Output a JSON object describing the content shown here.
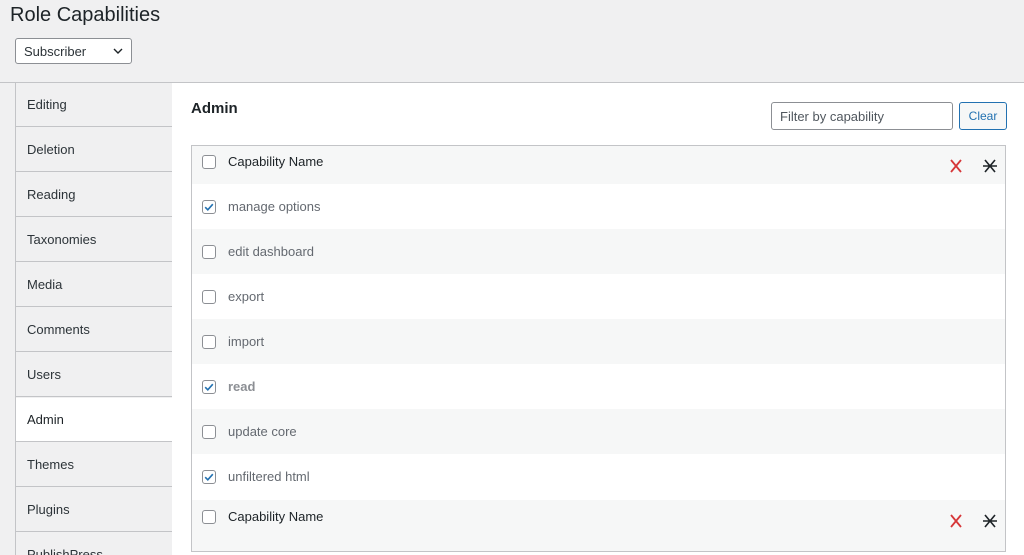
{
  "header": {
    "title": "Role Capabilities",
    "role_select": {
      "value": "Subscriber"
    }
  },
  "sidebar": {
    "items": [
      {
        "label": "Editing",
        "active": false
      },
      {
        "label": "Deletion",
        "active": false
      },
      {
        "label": "Reading",
        "active": false
      },
      {
        "label": "Taxonomies",
        "active": false
      },
      {
        "label": "Media",
        "active": false
      },
      {
        "label": "Comments",
        "active": false
      },
      {
        "label": "Users",
        "active": false
      },
      {
        "label": "Admin",
        "active": true
      },
      {
        "label": "Themes",
        "active": false
      },
      {
        "label": "Plugins",
        "active": false
      },
      {
        "label": "PublishPress",
        "active": false
      }
    ]
  },
  "main": {
    "section_title": "Admin",
    "filter": {
      "placeholder": "Filter by capability",
      "value": ""
    },
    "clear_label": "Clear",
    "header_row": {
      "label": "Capability Name",
      "checked": false
    },
    "footer_row": {
      "label": "Capability Name",
      "checked": false
    },
    "capabilities": [
      {
        "label": "manage options",
        "checked": true,
        "bold": false
      },
      {
        "label": "edit dashboard",
        "checked": false,
        "bold": false
      },
      {
        "label": "export",
        "checked": false,
        "bold": false
      },
      {
        "label": "import",
        "checked": false,
        "bold": false
      },
      {
        "label": "read",
        "checked": true,
        "bold": true
      },
      {
        "label": "update core",
        "checked": false,
        "bold": false
      },
      {
        "label": "unfiltered html",
        "checked": true,
        "bold": false
      }
    ]
  },
  "icons": {
    "deny_icon": "red-x-icon",
    "revoke_icon": "struck-x-icon",
    "select_chevron": "chevron-down-icon",
    "checkmark": "checkmark-icon"
  },
  "colors": {
    "accent": "#2271b1",
    "deny_red": "#d63638",
    "border": "#c3c4c7",
    "alt_row": "#f6f7f7"
  }
}
